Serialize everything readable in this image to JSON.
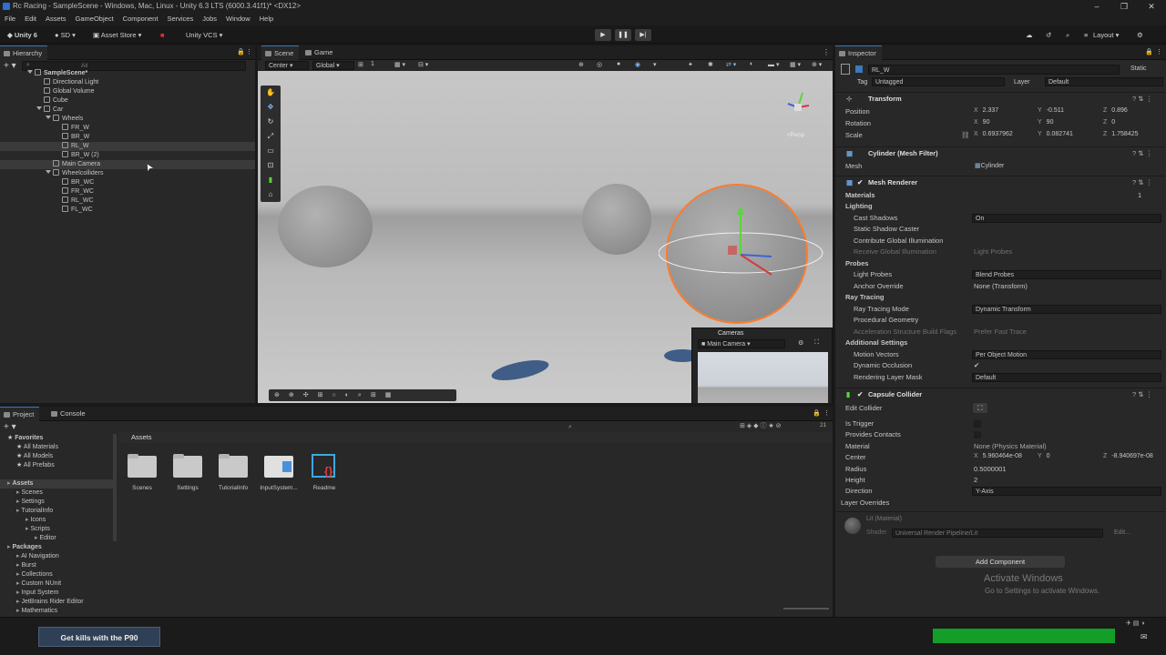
{
  "window": {
    "title": "Rc Racing - SampleScene - Windows, Mac, Linux - Unity 6.3 LTS (6000.3.41f1)* <DX12>"
  },
  "menu": [
    "File",
    "Edit",
    "Assets",
    "GameObject",
    "Component",
    "Services",
    "Jobs",
    "Window",
    "Help"
  ],
  "toolbar": {
    "account": "Unity 6",
    "user": "SD",
    "asset_store": "Asset Store",
    "vcs": "Unity VCS",
    "layout": "Layout"
  },
  "hierarchy": {
    "tab": "Hierarchy",
    "search_placeholder": "All",
    "items": [
      {
        "label": "SampleScene*",
        "depth": 0,
        "kind": "scene"
      },
      {
        "label": "Directional Light",
        "depth": 1
      },
      {
        "label": "Global Volume",
        "depth": 1
      },
      {
        "label": "Cube",
        "depth": 1
      },
      {
        "label": "Car",
        "depth": 1
      },
      {
        "label": "Wheels",
        "depth": 2
      },
      {
        "label": "FR_W",
        "depth": 3
      },
      {
        "label": "BR_W",
        "depth": 3
      },
      {
        "label": "RL_W",
        "depth": 3
      },
      {
        "label": "BR_W (2)",
        "depth": 3
      },
      {
        "label": "Main Camera",
        "depth": 2
      },
      {
        "label": "Wheelcolliders",
        "depth": 2
      },
      {
        "label": "BR_WC",
        "depth": 3
      },
      {
        "label": "FR_WC",
        "depth": 3
      },
      {
        "label": "RL_WC",
        "depth": 3
      },
      {
        "label": "FL_WC",
        "depth": 3
      }
    ]
  },
  "scene": {
    "tabs": [
      "Scene",
      "Game"
    ],
    "pivot": "Center",
    "space": "Global",
    "grid_snap": "1",
    "persp_label": "<Persp",
    "cameras_overlay": {
      "title": "Cameras",
      "selected": "Main Camera"
    }
  },
  "inspector": {
    "tab": "Inspector",
    "name": "RL_W",
    "static_label": "Static",
    "tag_label": "Tag",
    "tag": "Untagged",
    "layer_label": "Layer",
    "layer": "Default",
    "transform": {
      "title": "Transform",
      "position_label": "Position",
      "position": {
        "x": "2.337",
        "y": "-0.511",
        "z": "0.896"
      },
      "rotation_label": "Rotation",
      "rotation": {
        "x": "90",
        "y": "90",
        "z": "0"
      },
      "scale_label": "Scale",
      "scale": {
        "x": "0.6937962",
        "y": "0.082741",
        "z": "1.758425"
      }
    },
    "mesh_filter": {
      "title": "Cylinder (Mesh Filter)",
      "mesh_label": "Mesh",
      "mesh": "Cylinder"
    },
    "mesh_renderer": {
      "title": "Mesh Renderer",
      "materials_label": "Materials",
      "materials_count": "1",
      "lighting": "Lighting",
      "cast_shadows_label": "Cast Shadows",
      "cast_shadows": "On",
      "static_shadow_caster": "Static Shadow Caster",
      "contribute_gi": "Contribute Global Illumination",
      "receive_gi_label": "Receive Global Illumination",
      "receive_gi": "Light Probes",
      "probes": "Probes",
      "light_probes_label": "Light Probes",
      "light_probes": "Blend Probes",
      "anchor_override_label": "Anchor Override",
      "anchor_override": "None (Transform)",
      "ray_tracing": "Ray Tracing",
      "ray_tracing_mode_label": "Ray Tracing Mode",
      "ray_tracing_mode": "Dynamic Transform",
      "procedural_geometry": "Procedural Geometry",
      "accel_flags_label": "Acceleration Structure Build Flags",
      "accel_flags": "Prefer Fast Trace",
      "additional_settings": "Additional Settings",
      "motion_vectors_label": "Motion Vectors",
      "motion_vectors": "Per Object Motion",
      "dynamic_occlusion": "Dynamic Occlusion",
      "rendering_layer_mask_label": "Rendering Layer Mask",
      "rendering_layer_mask": "Default"
    },
    "capsule_collider": {
      "title": "Capsule Collider",
      "edit_collider": "Edit Collider",
      "is_trigger": "Is Trigger",
      "provides_contacts": "Provides Contacts",
      "material_label": "Material",
      "material": "None (Physics Material)",
      "center_label": "Center",
      "center": {
        "x": "5.960464e-08",
        "y": "0",
        "z": "-8.940697e-08"
      },
      "radius_label": "Radius",
      "radius": "0.5000001",
      "height_label": "Height",
      "height": "2",
      "direction_label": "Direction",
      "direction": "Y-Axis",
      "layer_overrides": "Layer Overrides"
    },
    "material": {
      "title": "Lit (Material)",
      "shader_label": "Shader",
      "shader": "Universal Render Pipeline/Lit",
      "edit": "Edit..."
    },
    "add_component": "Add Component"
  },
  "project": {
    "tabs": [
      "Project",
      "Console"
    ],
    "favorites_label": "Favorites",
    "favorites": [
      "All Materials",
      "All Models",
      "All Prefabs"
    ],
    "assets_root": "Assets",
    "asset_tree": [
      {
        "label": "Scenes",
        "depth": 1
      },
      {
        "label": "Settings",
        "depth": 1
      },
      {
        "label": "TutorialInfo",
        "depth": 1
      },
      {
        "label": "Icons",
        "depth": 2
      },
      {
        "label": "Scripts",
        "depth": 2
      },
      {
        "label": "Editor",
        "depth": 3
      }
    ],
    "packages_label": "Packages",
    "packages": [
      "AI Navigation",
      "Burst",
      "Collections",
      "Custom NUnit",
      "Input System",
      "JetBrains Rider Editor",
      "Mathematics"
    ],
    "breadcrumb": "Assets",
    "item_count": "21",
    "assets": [
      {
        "label": "Scenes",
        "kind": "folder"
      },
      {
        "label": "Settings",
        "kind": "folder"
      },
      {
        "label": "TutorialInfo",
        "kind": "folder"
      },
      {
        "label": "InputSystem...",
        "kind": "inputactions"
      },
      {
        "label": "Readme",
        "kind": "readme"
      }
    ]
  },
  "watermark": {
    "line1": "Activate Windows",
    "line2": "Go to Settings to activate Windows."
  },
  "ad_banner": "Get kills with the P90"
}
